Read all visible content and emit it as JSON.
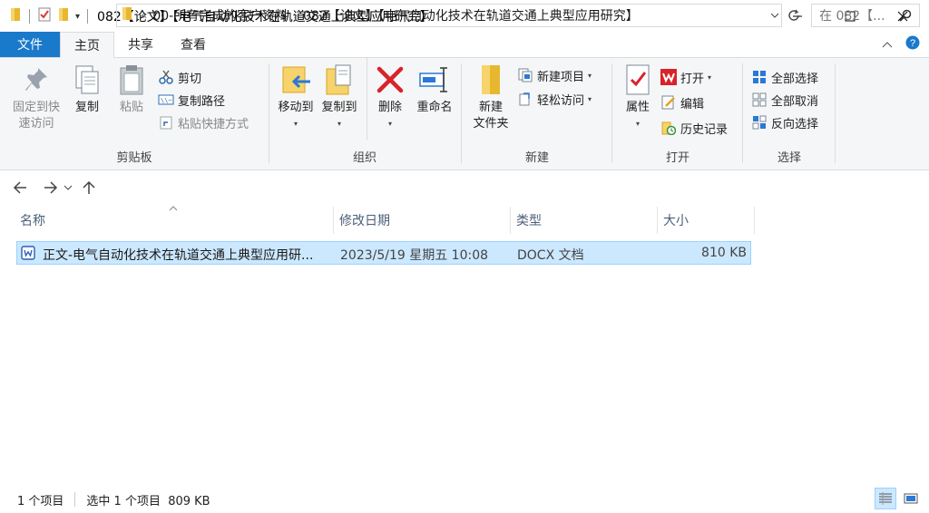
{
  "titlebar": {
    "title": "082【论文】【电气自动化技术在轨道交通上典型应用研究】",
    "controls": [
      "minimize",
      "maximize",
      "close"
    ]
  },
  "tabs": {
    "file": "文件",
    "home": "主页",
    "share": "共享",
    "view": "查看"
  },
  "ribbon": {
    "clipboard": {
      "label": "剪贴板",
      "pin": "固定到快速访问",
      "pin_line1": "固定到快",
      "pin_line2": "速访问",
      "copy": "复制",
      "paste": "粘贴",
      "cut": "剪切",
      "copy_path": "复制路径",
      "paste_shortcut": "粘贴快捷方式"
    },
    "organize": {
      "label": "组织",
      "move_to": "移动到",
      "copy_to": "复制到",
      "delete": "删除",
      "rename": "重命名"
    },
    "new": {
      "label": "新建",
      "new_folder_line1": "新建",
      "new_folder_line2": "文件夹",
      "new_item": "新建项目",
      "easy_access": "轻松访问"
    },
    "open": {
      "label": "打开",
      "properties": "属性",
      "open": "打开",
      "edit": "编辑",
      "history": "历史记录"
    },
    "select": {
      "label": "选择",
      "select_all": "全部选择",
      "select_none": "全部取消",
      "invert": "反向选择"
    }
  },
  "address": {
    "overflow": "«",
    "crumbs": [
      "00-所有完成的客户资料",
      "082【论文】【电气自动化技术在轨道交通上典型应用研究】"
    ],
    "search_placeholder": "在 082【..."
  },
  "columns": [
    "名称",
    "修改日期",
    "类型",
    "大小"
  ],
  "files": [
    {
      "name": "正文-电气自动化技术在轨道交通上典型应用研...",
      "modified": "2023/5/19 星期五 10:08",
      "type": "DOCX 文档",
      "size": "810 KB",
      "selected": true
    }
  ],
  "status": {
    "count": "1 个项目",
    "selection": "选中 1 个项目  809 KB"
  },
  "colors": {
    "accent": "#1979ca",
    "selection_bg": "#cce8ff",
    "selection_border": "#99d1ff"
  }
}
